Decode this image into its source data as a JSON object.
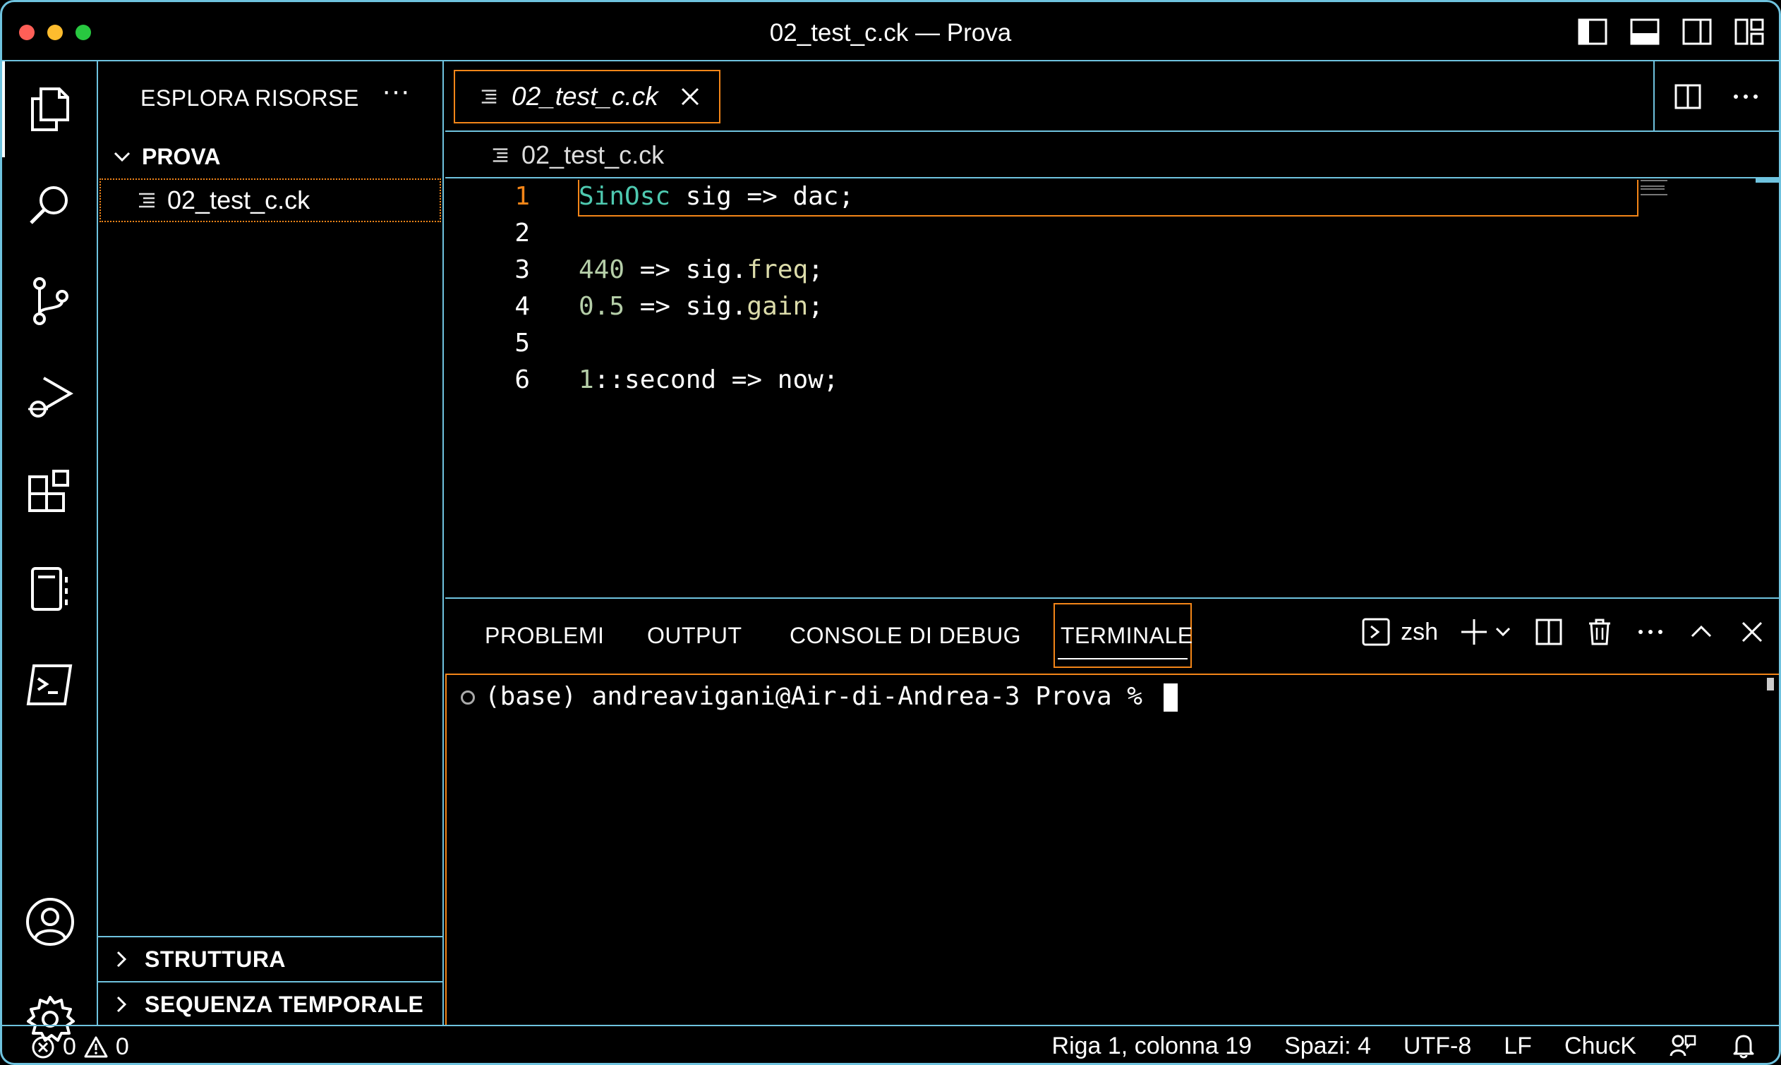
{
  "window": {
    "title": "02_test_c.ck — Prova",
    "traffic_colors": [
      "#ff5f57",
      "#febc2e",
      "#28c840"
    ],
    "accent_contrast": "#6fc3df",
    "focus_color": "#f38518"
  },
  "activity_bar": {
    "items": [
      "files-icon",
      "search-icon",
      "source-control-icon",
      "run-debug-icon",
      "extensions-icon",
      "notebook-icon",
      "terminal-icon"
    ],
    "bottom": [
      "account-icon",
      "settings-gear-icon"
    ]
  },
  "sidebar": {
    "header": "ESPLORA RISORSE",
    "more": "···",
    "folder": "PROVA",
    "files": [
      "02_test_c.ck"
    ],
    "sections": [
      "STRUTTURA",
      "SEQUENZA TEMPORALE"
    ]
  },
  "editor": {
    "tab_label": "02_test_c.ck",
    "breadcrumb": "02_test_c.ck",
    "line_numbers": [
      "1",
      "2",
      "3",
      "4",
      "5",
      "6"
    ],
    "lines": [
      [
        {
          "t": "SinOsc",
          "k": "type"
        },
        {
          "t": " sig => dac;",
          "k": "plain"
        }
      ],
      [],
      [
        {
          "t": "440",
          "k": "num"
        },
        {
          "t": " => sig.",
          "k": "plain"
        },
        {
          "t": "freq",
          "k": "fn"
        },
        {
          "t": ";",
          "k": "plain"
        }
      ],
      [
        {
          "t": "0.5",
          "k": "num"
        },
        {
          "t": " => sig.",
          "k": "plain"
        },
        {
          "t": "gain",
          "k": "fn"
        },
        {
          "t": ";",
          "k": "plain"
        }
      ],
      [],
      [
        {
          "t": "1",
          "k": "num"
        },
        {
          "t": "::second => now;",
          "k": "plain"
        }
      ]
    ]
  },
  "panel": {
    "tabs": [
      "PROBLEMI",
      "OUTPUT",
      "CONSOLE DI DEBUG",
      "TERMINALE"
    ],
    "active_tab": "TERMINALE",
    "shell": "zsh",
    "prompt": "(base) andreavigani@Air-di-Andrea-3 Prova % "
  },
  "status": {
    "errors": "0",
    "warnings": "0",
    "position": "Riga 1, colonna 19",
    "spaces": "Spazi: 4",
    "encoding": "UTF-8",
    "eol": "LF",
    "language": "ChucK"
  }
}
